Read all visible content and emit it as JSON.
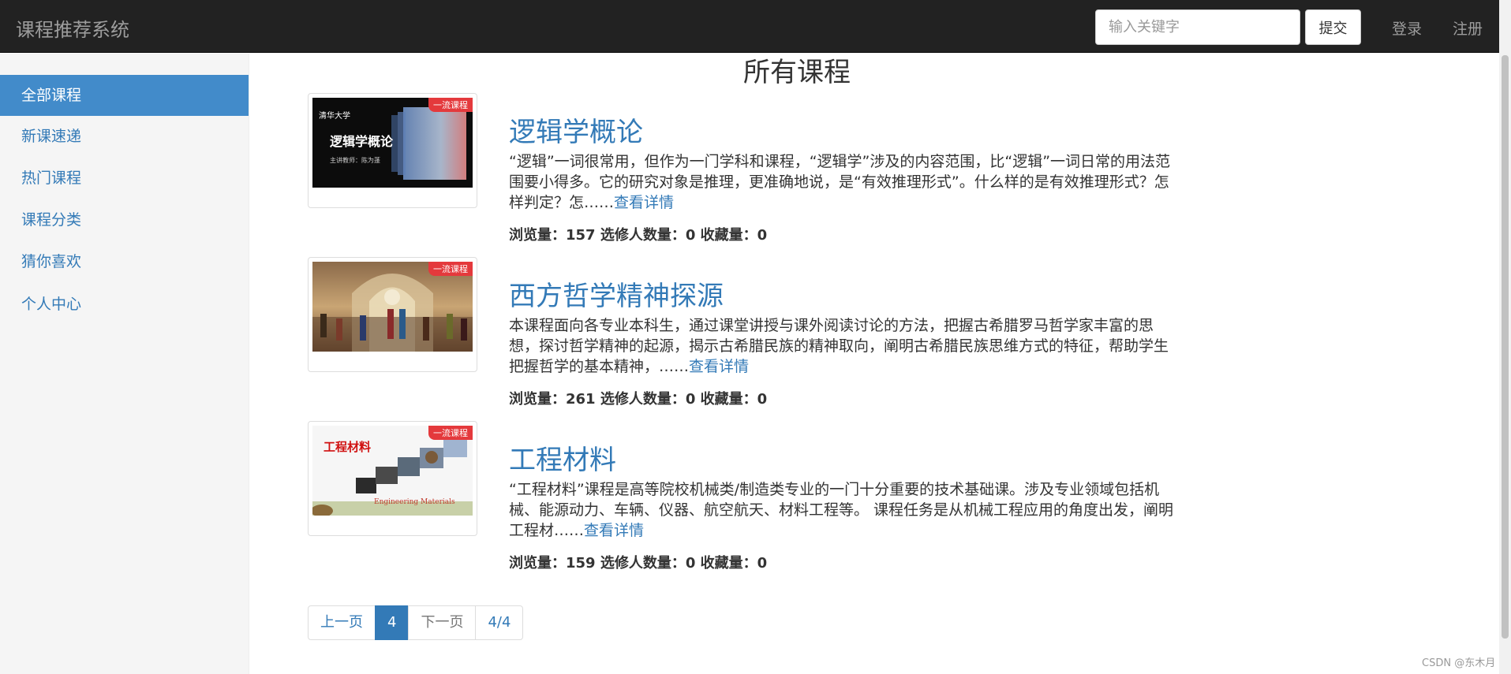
{
  "navbar": {
    "brand": "课程推荐系统",
    "search_placeholder": "输入关键字",
    "submit_label": "提交",
    "login_label": "登录",
    "register_label": "注册"
  },
  "sidebar": {
    "items": [
      {
        "label": "全部课程",
        "active": true
      },
      {
        "label": "新课速递"
      },
      {
        "label": "热门课程"
      },
      {
        "label": "课程分类"
      },
      {
        "label": "猜你喜欢"
      },
      {
        "label": "个人中心"
      }
    ]
  },
  "main": {
    "title": "所有课程",
    "courses": [
      {
        "badge": "一流课程",
        "title": "逻辑学概论",
        "thumb_text": "逻辑学概论",
        "thumb_sub": "主讲教师：陈为蓬",
        "thumb_logo": "清华大学",
        "description": "“逻辑”一词很常用，但作为一门学科和课程，“逻辑学”涉及的内容范围，比“逻辑”一词日常的用法范围要小得多。它的研究对象是推理，更准确地说，是“有效推理形式”。什么样的是有效推理形式？怎样判定？怎……",
        "more": "查看详情",
        "stats": "浏览量：157 选修人数量：0 收藏量：0"
      },
      {
        "badge": "一流课程",
        "title": "西方哲学精神探源",
        "description": "本课程面向各专业本科生，通过课堂讲授与课外阅读讨论的方法，把握古希腊罗马哲学家丰富的思想，探讨哲学精神的起源，揭示古希腊民族的精神取向，阐明古希腊民族思维方式的特征，帮助学生把握哲学的基本精神，……",
        "more": "查看详情",
        "stats": "浏览量：261 选修人数量：0 收藏量：0"
      },
      {
        "badge": "一流课程",
        "title": "工程材料",
        "thumb_text": "工程材料",
        "thumb_sub": "Engineering Materials",
        "description": "“工程材料”课程是高等院校机械类/制造类专业的一门十分重要的技术基础课。涉及专业领域包括机械、能源动力、车辆、仪器、航空航天、材料工程等。 课程任务是从机械工程应用的角度出发，阐明工程材……",
        "more": "查看详情",
        "stats": "浏览量：159 选修人数量：0 收藏量：0"
      }
    ]
  },
  "pagination": {
    "prev": "上一页",
    "current": "4",
    "next": "下一页",
    "info": "4/4"
  },
  "watermark": "CSDN @东木月"
}
